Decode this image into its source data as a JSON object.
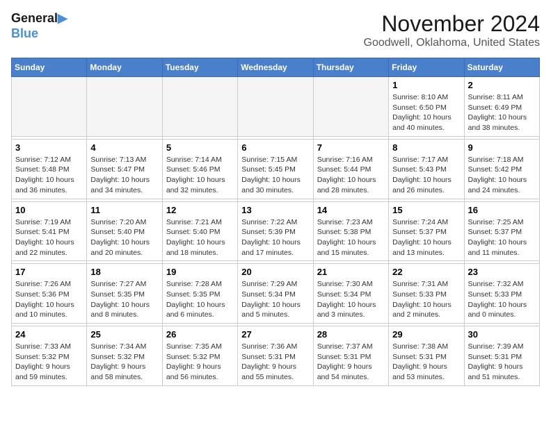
{
  "header": {
    "logo_line1": "General",
    "logo_line2": "Blue",
    "month": "November 2024",
    "location": "Goodwell, Oklahoma, United States"
  },
  "weekdays": [
    "Sunday",
    "Monday",
    "Tuesday",
    "Wednesday",
    "Thursday",
    "Friday",
    "Saturday"
  ],
  "weeks": [
    [
      {
        "day": "",
        "info": ""
      },
      {
        "day": "",
        "info": ""
      },
      {
        "day": "",
        "info": ""
      },
      {
        "day": "",
        "info": ""
      },
      {
        "day": "",
        "info": ""
      },
      {
        "day": "1",
        "info": "Sunrise: 8:10 AM\nSunset: 6:50 PM\nDaylight: 10 hours\nand 40 minutes."
      },
      {
        "day": "2",
        "info": "Sunrise: 8:11 AM\nSunset: 6:49 PM\nDaylight: 10 hours\nand 38 minutes."
      }
    ],
    [
      {
        "day": "3",
        "info": "Sunrise: 7:12 AM\nSunset: 5:48 PM\nDaylight: 10 hours\nand 36 minutes."
      },
      {
        "day": "4",
        "info": "Sunrise: 7:13 AM\nSunset: 5:47 PM\nDaylight: 10 hours\nand 34 minutes."
      },
      {
        "day": "5",
        "info": "Sunrise: 7:14 AM\nSunset: 5:46 PM\nDaylight: 10 hours\nand 32 minutes."
      },
      {
        "day": "6",
        "info": "Sunrise: 7:15 AM\nSunset: 5:45 PM\nDaylight: 10 hours\nand 30 minutes."
      },
      {
        "day": "7",
        "info": "Sunrise: 7:16 AM\nSunset: 5:44 PM\nDaylight: 10 hours\nand 28 minutes."
      },
      {
        "day": "8",
        "info": "Sunrise: 7:17 AM\nSunset: 5:43 PM\nDaylight: 10 hours\nand 26 minutes."
      },
      {
        "day": "9",
        "info": "Sunrise: 7:18 AM\nSunset: 5:42 PM\nDaylight: 10 hours\nand 24 minutes."
      }
    ],
    [
      {
        "day": "10",
        "info": "Sunrise: 7:19 AM\nSunset: 5:41 PM\nDaylight: 10 hours\nand 22 minutes."
      },
      {
        "day": "11",
        "info": "Sunrise: 7:20 AM\nSunset: 5:40 PM\nDaylight: 10 hours\nand 20 minutes."
      },
      {
        "day": "12",
        "info": "Sunrise: 7:21 AM\nSunset: 5:40 PM\nDaylight: 10 hours\nand 18 minutes."
      },
      {
        "day": "13",
        "info": "Sunrise: 7:22 AM\nSunset: 5:39 PM\nDaylight: 10 hours\nand 17 minutes."
      },
      {
        "day": "14",
        "info": "Sunrise: 7:23 AM\nSunset: 5:38 PM\nDaylight: 10 hours\nand 15 minutes."
      },
      {
        "day": "15",
        "info": "Sunrise: 7:24 AM\nSunset: 5:37 PM\nDaylight: 10 hours\nand 13 minutes."
      },
      {
        "day": "16",
        "info": "Sunrise: 7:25 AM\nSunset: 5:37 PM\nDaylight: 10 hours\nand 11 minutes."
      }
    ],
    [
      {
        "day": "17",
        "info": "Sunrise: 7:26 AM\nSunset: 5:36 PM\nDaylight: 10 hours\nand 10 minutes."
      },
      {
        "day": "18",
        "info": "Sunrise: 7:27 AM\nSunset: 5:35 PM\nDaylight: 10 hours\nand 8 minutes."
      },
      {
        "day": "19",
        "info": "Sunrise: 7:28 AM\nSunset: 5:35 PM\nDaylight: 10 hours\nand 6 minutes."
      },
      {
        "day": "20",
        "info": "Sunrise: 7:29 AM\nSunset: 5:34 PM\nDaylight: 10 hours\nand 5 minutes."
      },
      {
        "day": "21",
        "info": "Sunrise: 7:30 AM\nSunset: 5:34 PM\nDaylight: 10 hours\nand 3 minutes."
      },
      {
        "day": "22",
        "info": "Sunrise: 7:31 AM\nSunset: 5:33 PM\nDaylight: 10 hours\nand 2 minutes."
      },
      {
        "day": "23",
        "info": "Sunrise: 7:32 AM\nSunset: 5:33 PM\nDaylight: 10 hours\nand 0 minutes."
      }
    ],
    [
      {
        "day": "24",
        "info": "Sunrise: 7:33 AM\nSunset: 5:32 PM\nDaylight: 9 hours\nand 59 minutes."
      },
      {
        "day": "25",
        "info": "Sunrise: 7:34 AM\nSunset: 5:32 PM\nDaylight: 9 hours\nand 58 minutes."
      },
      {
        "day": "26",
        "info": "Sunrise: 7:35 AM\nSunset: 5:32 PM\nDaylight: 9 hours\nand 56 minutes."
      },
      {
        "day": "27",
        "info": "Sunrise: 7:36 AM\nSunset: 5:31 PM\nDaylight: 9 hours\nand 55 minutes."
      },
      {
        "day": "28",
        "info": "Sunrise: 7:37 AM\nSunset: 5:31 PM\nDaylight: 9 hours\nand 54 minutes."
      },
      {
        "day": "29",
        "info": "Sunrise: 7:38 AM\nSunset: 5:31 PM\nDaylight: 9 hours\nand 53 minutes."
      },
      {
        "day": "30",
        "info": "Sunrise: 7:39 AM\nSunset: 5:31 PM\nDaylight: 9 hours\nand 51 minutes."
      }
    ]
  ]
}
